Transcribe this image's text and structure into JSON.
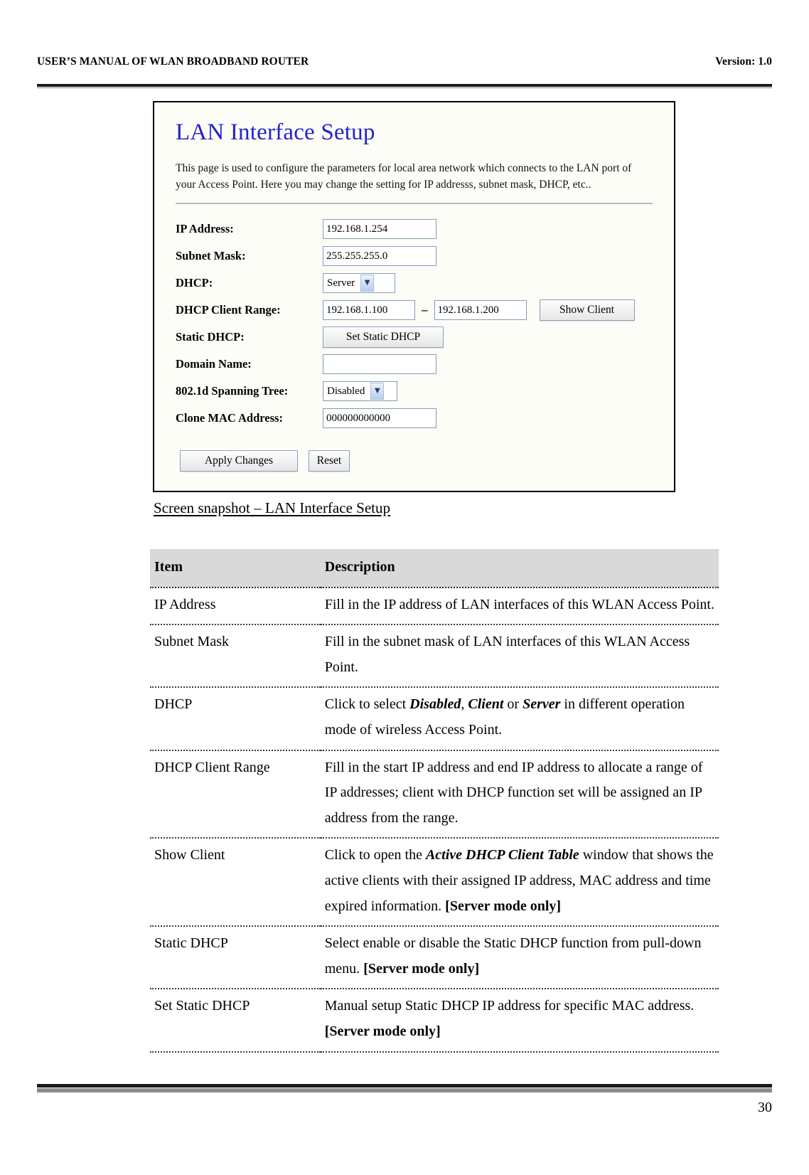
{
  "document": {
    "header_left": "USER’S MANUAL OF WLAN BROADBAND ROUTER",
    "header_right": "Version: 1.0",
    "page_number": "30",
    "caption": "Screen snapshot – LAN Interface Setup"
  },
  "screenshot": {
    "title": "LAN Interface Setup",
    "description": "This page is used to configure the parameters for local area network which connects to the LAN port of your Access Point. Here you may change the setting for IP addresss, subnet mask, DHCP, etc..",
    "title_color": "#2222cc",
    "fields": {
      "ip_address": {
        "label": "IP Address:",
        "value": "192.168.1.254"
      },
      "subnet_mask": {
        "label": "Subnet Mask:",
        "value": "255.255.255.0"
      },
      "dhcp": {
        "label": "DHCP:",
        "value": "Server"
      },
      "dhcp_client_range": {
        "label": "DHCP Client Range:",
        "start": "192.168.1.100",
        "separator": "–",
        "end": "192.168.1.200",
        "show_client_label": "Show Client"
      },
      "static_dhcp": {
        "label": "Static DHCP:",
        "button_label": "Set Static DHCP"
      },
      "domain_name": {
        "label": "Domain Name:",
        "value": "",
        "placeholder": ""
      },
      "spanning_tree": {
        "label": "802.1d Spanning Tree:",
        "value": "Disabled"
      },
      "clone_mac": {
        "label": "Clone MAC Address:",
        "value": "000000000000"
      }
    },
    "actions": {
      "apply_label": "Apply Changes",
      "reset_label": "Reset"
    }
  },
  "table": {
    "headers": {
      "item": "Item",
      "description": "Description"
    },
    "rows": [
      {
        "item": "IP Address",
        "desc_parts": [
          {
            "text": "Fill in the IP address of LAN interfaces of this WLAN Access Point.",
            "style": "normal"
          }
        ]
      },
      {
        "item": "Subnet Mask",
        "desc_parts": [
          {
            "text": "Fill in the subnet mask of LAN interfaces of this WLAN Access Point.",
            "style": "normal"
          }
        ]
      },
      {
        "item": "DHCP",
        "desc_parts": [
          {
            "text": "Click to select ",
            "style": "normal"
          },
          {
            "text": "Disabled",
            "style": "bold-italic"
          },
          {
            "text": ", ",
            "style": "normal"
          },
          {
            "text": "Client",
            "style": "bold-italic"
          },
          {
            "text": " or ",
            "style": "normal"
          },
          {
            "text": "Server",
            "style": "bold-italic"
          },
          {
            "text": " in different operation mode of wireless Access Point.",
            "style": "normal"
          }
        ]
      },
      {
        "item": "DHCP Client Range",
        "desc_parts": [
          {
            "text": "Fill in the start IP address and end IP address to allocate a range of IP addresses; client with DHCP function set will be assigned an IP address from the range.",
            "style": "normal"
          }
        ]
      },
      {
        "item": "Show Client",
        "desc_parts": [
          {
            "text": "Click to open the ",
            "style": "normal"
          },
          {
            "text": "Active DHCP Client Table",
            "style": "bold-italic"
          },
          {
            "text": " window that shows the active clients with their assigned IP address, MAC address and time expired information. ",
            "style": "normal"
          },
          {
            "text": "[Server mode only]",
            "style": "bold"
          }
        ]
      },
      {
        "item": "Static DHCP",
        "desc_parts": [
          {
            "text": "Select enable or disable the Static DHCP function from pull-down menu. ",
            "style": "normal"
          },
          {
            "text": "[Server mode only]",
            "style": "bold"
          }
        ]
      },
      {
        "item": "Set Static DHCP",
        "desc_parts": [
          {
            "text": "Manual setup Static DHCP IP address for specific MAC address. ",
            "style": "normal"
          },
          {
            "text": "[Server mode only]",
            "style": "bold"
          }
        ]
      }
    ]
  }
}
